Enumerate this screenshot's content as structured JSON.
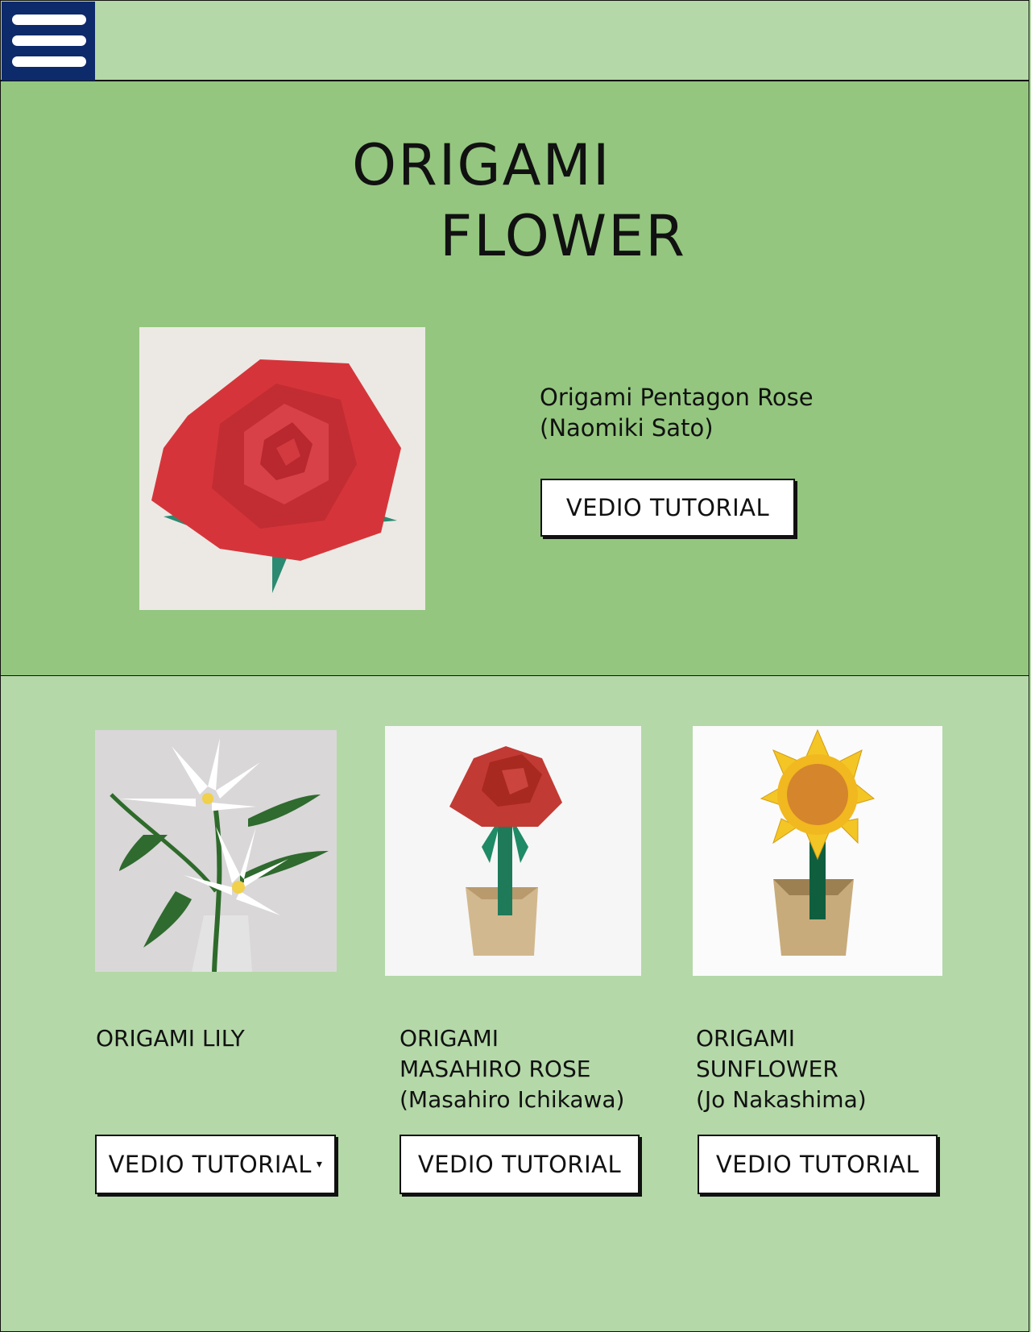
{
  "header": {
    "menu_icon": "hamburger-menu-icon"
  },
  "hero": {
    "title_line1": "ORIGAMI",
    "title_line2": "FLOWER",
    "image_alt": "red origami pentagon rose",
    "name_line1": "Origami Pentagon Rose",
    "name_line2": "(Naomiki Sato)",
    "button_label": "VEDIO TUTORIAL"
  },
  "cards": [
    {
      "image_alt": "white origami lilies in glass vase",
      "lines": [
        "ORIGAMI LILY"
      ],
      "button_label": "VEDIO TUTORIAL",
      "button_icon": "caret-down-icon"
    },
    {
      "image_alt": "red origami rose in paper pot",
      "lines": [
        "ORIGAMI",
        "MASAHIRO ROSE",
        "(Masahiro Ichikawa)"
      ],
      "button_label": "VEDIO TUTORIAL"
    },
    {
      "image_alt": "origami sunflower in paper pot",
      "lines": [
        "ORIGAMI",
        "SUNFLOWER",
        "(Jo Nakashima)"
      ],
      "button_label": "VEDIO TUTORIAL"
    }
  ],
  "colors": {
    "topbar": "#b4d8a8",
    "hero": "#94c67f",
    "menu": "#0d2a6b"
  }
}
